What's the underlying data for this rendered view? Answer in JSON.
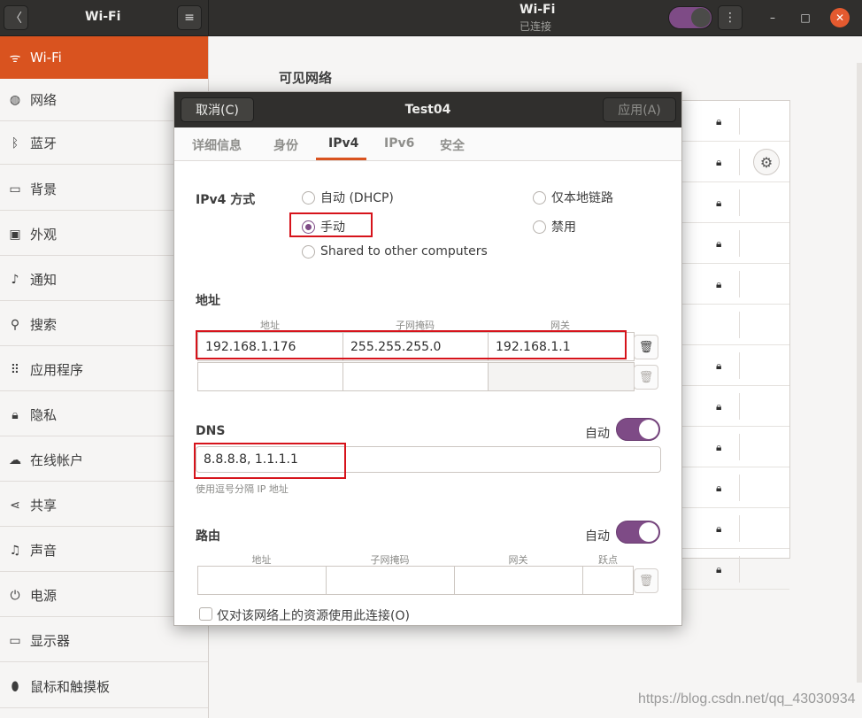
{
  "header": {
    "sidebar_title": "Wi-Fi",
    "main_title": "Wi-Fi",
    "main_subtitle": "已连接",
    "back_glyph": "〈",
    "menu_glyph": "≡",
    "more_glyph": "⋮",
    "minimize_glyph": "–",
    "maximize_glyph": "□",
    "close_glyph": "✕"
  },
  "sidebar": {
    "items": [
      {
        "label": "Wi-Fi",
        "icon": "wifi-icon",
        "glyph": "ᯤ"
      },
      {
        "label": "网络",
        "icon": "network-icon",
        "glyph": "◍"
      },
      {
        "label": "蓝牙",
        "icon": "bluetooth-icon",
        "glyph": "ᛒ"
      },
      {
        "label": "背景",
        "icon": "background-icon",
        "glyph": "▭"
      },
      {
        "label": "外观",
        "icon": "appearance-icon",
        "glyph": "▣"
      },
      {
        "label": "通知",
        "icon": "notification-icon",
        "glyph": "♪"
      },
      {
        "label": "搜索",
        "icon": "search-icon",
        "glyph": "⚲"
      },
      {
        "label": "应用程序",
        "icon": "applications-icon",
        "glyph": "⠿"
      },
      {
        "label": "隐私",
        "icon": "privacy-icon",
        "glyph": "🔒︎"
      },
      {
        "label": "在线帐户",
        "icon": "cloud-icon",
        "glyph": "☁"
      },
      {
        "label": "共享",
        "icon": "share-icon",
        "glyph": "⋖"
      },
      {
        "label": "声音",
        "icon": "sound-icon",
        "glyph": "♫"
      },
      {
        "label": "电源",
        "icon": "power-icon",
        "glyph": "⏻"
      },
      {
        "label": "显示器",
        "icon": "display-icon",
        "glyph": "▭"
      },
      {
        "label": "鼠标和触摸板",
        "icon": "mouse-icon",
        "glyph": "⬮"
      }
    ]
  },
  "main": {
    "visible_networks_title": "可见网络",
    "network_rows": 12
  },
  "dialog": {
    "cancel_label": "取消(C)",
    "title": "Test04",
    "apply_label": "应用(A)",
    "tabs": [
      "详细信息",
      "身份",
      "IPv4",
      "IPv6",
      "安全"
    ],
    "active_tab": "IPv4",
    "ipv4_method_label": "IPv4 方式",
    "methods": {
      "auto_dhcp": "自动 (DHCP)",
      "manual": "手动",
      "shared": "Shared to other computers",
      "link_local": "仅本地链路",
      "disabled": "禁用"
    },
    "selected_method": "manual",
    "address_section": "地址",
    "address_columns": [
      "地址",
      "子网掩码",
      "网关"
    ],
    "address_rows": [
      {
        "address": "192.168.1.176",
        "netmask": "255.255.255.0",
        "gateway": "192.168.1.1"
      },
      {
        "address": "",
        "netmask": "",
        "gateway": ""
      }
    ],
    "dns_section": "DNS",
    "dns_auto_label": "自动",
    "dns_auto": true,
    "dns_value": "8.8.8.8, 1.1.1.1",
    "dns_hint": "使用逗号分隔 IP 地址",
    "routes_section": "路由",
    "routes_auto_label": "自动",
    "routes_auto": true,
    "route_columns": [
      "地址",
      "子网掩码",
      "网关",
      "跃点"
    ],
    "only_local_resources_label": "仅对该网络上的资源使用此连接(O)",
    "only_local_resources": false
  },
  "watermark": "https://blog.csdn.net/qq_43030934",
  "colors": {
    "accent_orange": "#d9531f",
    "accent_purple": "#7e4b86",
    "highlight_red": "#d6131b",
    "headerbar": "#302f2d"
  }
}
